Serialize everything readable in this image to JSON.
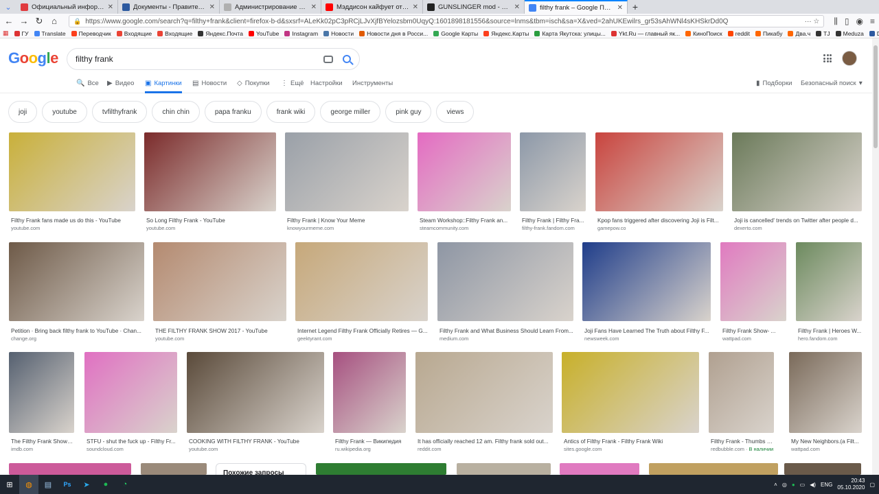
{
  "browser": {
    "tabs": [
      {
        "title": "Официальный информацио",
        "color": "#e03a3e",
        "active": false
      },
      {
        "title": "Документы - Правительство",
        "color": "#2d5aa0",
        "active": false
      },
      {
        "title": "Администрирование портала Раб",
        "color": "#b0b0b0",
        "active": false
      },
      {
        "title": "Мэддисон кайфует от мода St",
        "color": "#ff0000",
        "active": false
      },
      {
        "title": "GUNSLINGER mod - Моды Зов",
        "color": "#222222",
        "active": false
      },
      {
        "title": "filthy frank – Google Поиск",
        "color": "#4285f4",
        "active": true
      }
    ],
    "url": "https://www.google.com/search?q=filthy+frank&client=firefox-b-d&sxsrf=ALeKk02pC3pRCjLJvXjfBYelozsbm0UqyQ:1601898181556&source=lnms&tbm=isch&sa=X&ved=2ahUKEwilrs_gr53sAhWNl4sKHSkrDd0Q",
    "bookmarks": [
      {
        "label": "ГУ",
        "color": "#d33"
      },
      {
        "label": "Translate",
        "color": "#4285f4"
      },
      {
        "label": "Переводчик",
        "color": "#fc3f1d"
      },
      {
        "label": "Входящие",
        "color": "#ea4335"
      },
      {
        "label": "Входящие",
        "color": "#ea4335"
      },
      {
        "label": "Яндекс.Почта",
        "color": "#333"
      },
      {
        "label": "YouTube",
        "color": "#ff0000"
      },
      {
        "label": "Instagram",
        "color": "#c13584"
      },
      {
        "label": "Новости",
        "color": "#4a76a8"
      },
      {
        "label": "Новости дня в Росси...",
        "color": "#e05a00"
      },
      {
        "label": "Google Карты",
        "color": "#34a853"
      },
      {
        "label": "Яндекс.Карты",
        "color": "#fc3f1d"
      },
      {
        "label": "Карта Якутска: улицы...",
        "color": "#2a9d3f"
      },
      {
        "label": "Ykt.Ru — главный як...",
        "color": "#d33"
      },
      {
        "label": "КиноПоиск",
        "color": "#f60"
      },
      {
        "label": "reddit",
        "color": "#ff4500"
      },
      {
        "label": "Пикабу",
        "color": "#f60"
      },
      {
        "label": "Два.ч",
        "color": "#f60"
      },
      {
        "label": "TJ",
        "color": "#333"
      },
      {
        "label": "Meduza",
        "color": "#333"
      },
      {
        "label": "DTF",
        "color": "#2d5aa0"
      }
    ]
  },
  "search": {
    "logo": "Google",
    "query": "filthy frank"
  },
  "tools": {
    "items": [
      {
        "label": "Все",
        "icon": "🔍"
      },
      {
        "label": "Видео",
        "icon": "▶"
      },
      {
        "label": "Картинки",
        "icon": "▣"
      },
      {
        "label": "Новости",
        "icon": "▤"
      },
      {
        "label": "Покупки",
        "icon": "◇"
      },
      {
        "label": "Ещё",
        "icon": "⋮"
      }
    ],
    "settings": "Настройки",
    "instruments": "Инструменты",
    "collections": "Подборки",
    "safesearch": "Безопасный поиск"
  },
  "chips": [
    "joji",
    "youtube",
    "tvfilthyfrank",
    "chin chin",
    "papa franku",
    "frank wiki",
    "george miller",
    "pink guy",
    "views"
  ],
  "results": [
    {
      "caption": "Filthy Frank fans made us do this - YouTube",
      "source": "youtube.com",
      "color": "#c9b03a"
    },
    {
      "caption": "So Long Filthy Frank - YouTube",
      "source": "youtube.com",
      "color": "#7b2b2b"
    },
    {
      "caption": "Filthy Frank | Know Your Meme",
      "source": "knowyourmeme.com",
      "color": "#9aa0a8"
    },
    {
      "caption": "Steam Workshop::Filthy Frank an...",
      "source": "steamcommunity.com",
      "color": "#e46bc2"
    },
    {
      "caption": "Filthy Frank | Filthy Fra...",
      "source": "filthy-frank.fandom.com",
      "color": "#8c98a8"
    },
    {
      "caption": "Kpop fans triggered after discovering Joji is Filt...",
      "source": "gamepow.co",
      "color": "#c9443e"
    },
    {
      "caption": "Joji is cancelled' trends on Twitter after people d...",
      "source": "dexerto.com",
      "color": "#6b7a5a"
    },
    {
      "caption": "Petition · Bring back filthy frank to YouTube · Chan...",
      "source": "change.org",
      "color": "#6e5a48"
    },
    {
      "caption": "THE FILTHY FRANK SHOW 2017 - YouTube",
      "source": "youtube.com",
      "color": "#b48a70"
    },
    {
      "caption": "Internet Legend Filthy Frank Officially Retires — G...",
      "source": "geektyrant.com",
      "color": "#c6a87a"
    },
    {
      "caption": "Filthy Frank and What Business Should Learn From...",
      "source": "medium.com",
      "color": "#8e96a4"
    },
    {
      "caption": "Joji Fans Have Learned The Truth about Filthy F...",
      "source": "newsweek.com",
      "color": "#1f3d8a"
    },
    {
      "caption": "Filthy Frank Show- ...",
      "source": "wattpad.com",
      "color": "#e07ac0"
    },
    {
      "caption": "Filthy Frank | Heroes W...",
      "source": "hero.fandom.com",
      "color": "#6c8a5e"
    },
    {
      "caption": "The Filthy Frank Show\" ...",
      "source": "imdb.com",
      "color": "#556070"
    },
    {
      "caption": "STFU - shut the fuck up - Filthy Fr...",
      "source": "soundcloud.com",
      "color": "#e070c2"
    },
    {
      "caption": "COOKING WITH FILTHY FRANK - YouTube",
      "source": "youtube.com",
      "color": "#5a4a3a"
    },
    {
      "caption": "Filthy Frank — Википедия",
      "source": "ru.wikipedia.org",
      "color": "#a65080"
    },
    {
      "caption": "It has officially reached 12 am. Filthy frank sold out...",
      "source": "reddit.com",
      "color": "#b8a890"
    },
    {
      "caption": "Antics of Filthy Frank - Filthy Frank Wiki",
      "source": "sites.google.com",
      "color": "#c8b02a"
    },
    {
      "caption": "Filthy Frank - Thumbs Up ...",
      "source": "redbubble.com",
      "color": "#b0a090",
      "badge": "В наличии"
    },
    {
      "caption": "My New Neighbors.(a Filt...",
      "source": "wattpad.com",
      "color": "#7a6a5a"
    }
  ],
  "partial_row_colors": [
    "#cc5a9a",
    "#9a8a7a",
    "#2e7d32",
    "#b8b0a0",
    "#e07ac0",
    "#c0a060",
    "#6a5a4a"
  ],
  "related_label": "Похожие запросы",
  "taskbar": {
    "lang": "ENG",
    "time": "20:43",
    "date": "05.10.2020"
  }
}
